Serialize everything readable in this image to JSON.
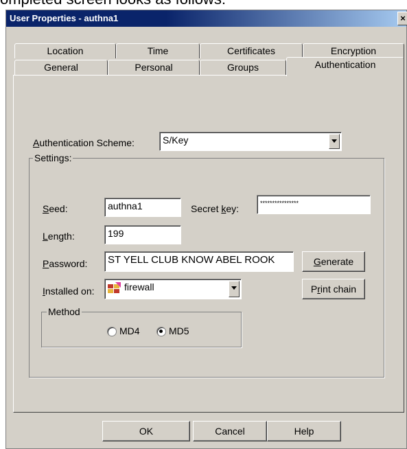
{
  "doc_text": "ompleted screen looks as follows:",
  "window": {
    "title": "User Properties - authna1",
    "close": "×"
  },
  "tabs_row1": [
    "Location",
    "Time",
    "Certificates",
    "Encryption"
  ],
  "tabs_row2": [
    "General",
    "Personal",
    "Groups",
    "Authentication"
  ],
  "active_tab": "Authentication",
  "auth": {
    "scheme_label": "Authentication Scheme:",
    "scheme_value": "S/Key",
    "settings_label": "Settings:",
    "seed_label": "Seed:",
    "seed_value": "authna1",
    "secret_label": "Secret key:",
    "secret_value": "****************",
    "length_label": "Length:",
    "length_value": "199",
    "password_label": "Password:",
    "password_value": "ST YELL CLUB KNOW ABEL ROOK",
    "generate_label": "Generate",
    "installed_label": "Installed on:",
    "installed_value": "firewall",
    "print_chain_label": "Print chain",
    "method_label": "Method",
    "md4_label": "MD4",
    "md5_label": "MD5",
    "method_selected": "MD5"
  },
  "buttons": {
    "ok": "OK",
    "cancel": "Cancel",
    "help": "Help"
  }
}
